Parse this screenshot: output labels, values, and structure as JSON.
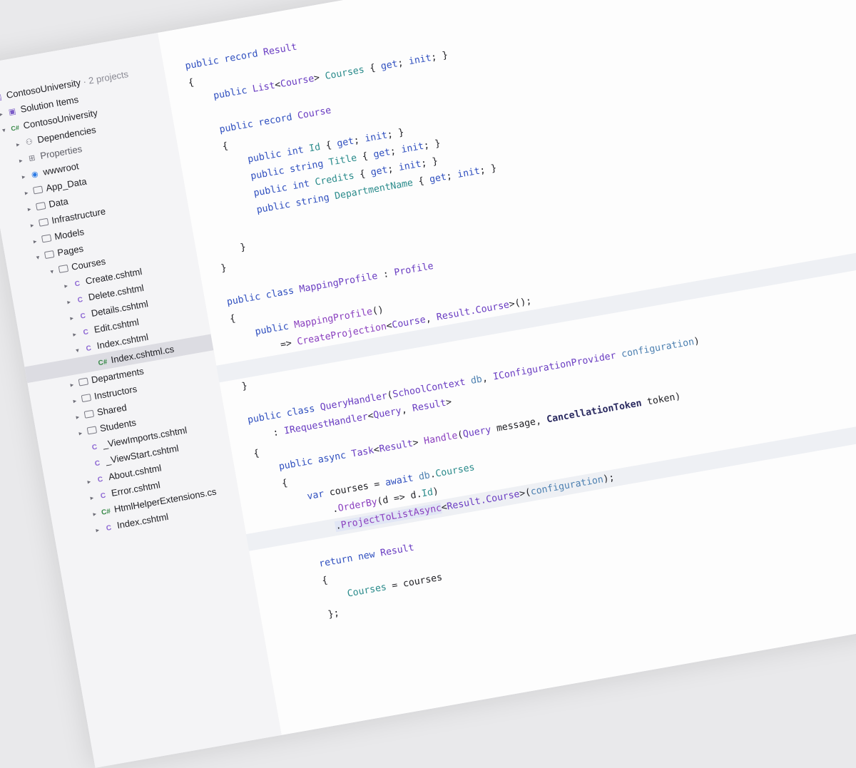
{
  "solution_tree": {
    "root": {
      "label": "ContosoUniversity",
      "meta": "· 2 projects"
    },
    "nodes": [
      {
        "label": "Solution Items",
        "depth": 1,
        "chevron": "▸",
        "icon": "solution-folder-icon"
      },
      {
        "label": "ContosoUniversity",
        "depth": 1,
        "chevron": "▾",
        "icon": "csharp-project-icon"
      },
      {
        "label": "Dependencies",
        "depth": 2,
        "chevron": "▸",
        "icon": "dependencies-icon"
      },
      {
        "label": "Properties",
        "depth": 2,
        "chevron": "▸",
        "icon": "properties-icon"
      },
      {
        "label": "wwwroot",
        "depth": 2,
        "chevron": "▸",
        "icon": "web-folder-icon"
      },
      {
        "label": "App_Data",
        "depth": 2,
        "chevron": "▸",
        "icon": "folder-icon"
      },
      {
        "label": "Data",
        "depth": 2,
        "chevron": "▸",
        "icon": "folder-icon"
      },
      {
        "label": "Infrastructure",
        "depth": 2,
        "chevron": "▸",
        "icon": "folder-icon"
      },
      {
        "label": "Models",
        "depth": 2,
        "chevron": "▸",
        "icon": "folder-icon"
      },
      {
        "label": "Pages",
        "depth": 2,
        "chevron": "▾",
        "icon": "folder-icon"
      },
      {
        "label": "Courses",
        "depth": 3,
        "chevron": "▾",
        "icon": "folder-icon"
      },
      {
        "label": "Create.cshtml",
        "depth": 4,
        "chevron": "▸",
        "icon": "razor-file-icon"
      },
      {
        "label": "Delete.cshtml",
        "depth": 4,
        "chevron": "▸",
        "icon": "razor-file-icon"
      },
      {
        "label": "Details.cshtml",
        "depth": 4,
        "chevron": "▸",
        "icon": "razor-file-icon"
      },
      {
        "label": "Edit.cshtml",
        "depth": 4,
        "chevron": "▸",
        "icon": "razor-file-icon"
      },
      {
        "label": "Index.cshtml",
        "depth": 4,
        "chevron": "▾",
        "icon": "razor-file-icon"
      },
      {
        "label": "Index.cshtml.cs",
        "depth": 5,
        "chevron": "",
        "icon": "csharp-file-icon",
        "selected": true
      },
      {
        "label": "Departments",
        "depth": 3,
        "chevron": "▸",
        "icon": "folder-icon"
      },
      {
        "label": "Instructors",
        "depth": 3,
        "chevron": "▸",
        "icon": "folder-icon"
      },
      {
        "label": "Shared",
        "depth": 3,
        "chevron": "▸",
        "icon": "folder-icon"
      },
      {
        "label": "Students",
        "depth": 3,
        "chevron": "▸",
        "icon": "folder-icon"
      },
      {
        "label": "_ViewImports.cshtml",
        "depth": 3,
        "chevron": "",
        "icon": "razor-file-icon"
      },
      {
        "label": "_ViewStart.cshtml",
        "depth": 3,
        "chevron": "",
        "icon": "razor-file-icon"
      },
      {
        "label": "About.cshtml",
        "depth": 3,
        "chevron": "▸",
        "icon": "razor-file-icon"
      },
      {
        "label": "Error.cshtml",
        "depth": 3,
        "chevron": "▸",
        "icon": "razor-file-icon"
      },
      {
        "label": "HtmlHelperExtensions.cs",
        "depth": 3,
        "chevron": "▸",
        "icon": "csharp-file-icon"
      },
      {
        "label": "Index.cshtml",
        "depth": 3,
        "chevron": "▸",
        "icon": "razor-file-icon"
      }
    ]
  },
  "code_lines": [
    {
      "indent": 0,
      "tokens": [
        [
          "kw",
          "public"
        ],
        [
          "",
          ""
        ],
        [
          "kw",
          " record "
        ],
        [
          "ty",
          "Result"
        ]
      ]
    },
    {
      "indent": 0,
      "tokens": [
        [
          "",
          "{"
        ]
      ]
    },
    {
      "indent": 4,
      "tokens": [
        [
          "kw",
          "public "
        ],
        [
          "ty",
          "List"
        ],
        [
          "",
          "<"
        ],
        [
          "ty",
          "Course"
        ],
        [
          "",
          "> "
        ],
        [
          "pr",
          "Courses"
        ],
        [
          "",
          " { "
        ],
        [
          "kw",
          "get"
        ],
        [
          "",
          "; "
        ],
        [
          "kw",
          "init"
        ],
        [
          "",
          "; }"
        ]
      ]
    },
    {
      "indent": 0,
      "tokens": []
    },
    {
      "indent": 4,
      "tokens": [
        [
          "kw",
          "public record "
        ],
        [
          "ty",
          "Course"
        ]
      ]
    },
    {
      "indent": 4,
      "tokens": [
        [
          "",
          "{"
        ]
      ]
    },
    {
      "indent": 8,
      "tokens": [
        [
          "kw",
          "public int "
        ],
        [
          "pr",
          "Id"
        ],
        [
          "",
          " { "
        ],
        [
          "kw",
          "get"
        ],
        [
          "",
          "; "
        ],
        [
          "kw",
          "init"
        ],
        [
          "",
          "; }"
        ]
      ]
    },
    {
      "indent": 8,
      "tokens": [
        [
          "kw",
          "public string "
        ],
        [
          "pr",
          "Title"
        ],
        [
          "",
          " { "
        ],
        [
          "kw",
          "get"
        ],
        [
          "",
          "; "
        ],
        [
          "kw",
          "init"
        ],
        [
          "",
          "; }"
        ]
      ]
    },
    {
      "indent": 8,
      "tokens": [
        [
          "kw",
          "public int "
        ],
        [
          "pr",
          "Credits"
        ],
        [
          "",
          " { "
        ],
        [
          "kw",
          "get"
        ],
        [
          "",
          "; "
        ],
        [
          "kw",
          "init"
        ],
        [
          "",
          "; }"
        ]
      ]
    },
    {
      "indent": 8,
      "tokens": [
        [
          "kw",
          "public string "
        ],
        [
          "pr",
          "DepartmentName"
        ],
        [
          "",
          " { "
        ],
        [
          "kw",
          "get"
        ],
        [
          "",
          "; "
        ],
        [
          "kw",
          "init"
        ],
        [
          "",
          "; }"
        ]
      ]
    },
    {
      "indent": 0,
      "tokens": []
    },
    {
      "indent": 4,
      "tokens": [
        [
          "",
          "}"
        ]
      ]
    },
    {
      "indent": 0,
      "tokens": [
        [
          "",
          "}"
        ]
      ]
    },
    {
      "indent": 0,
      "tokens": []
    },
    {
      "indent": 0,
      "tokens": [
        [
          "kw",
          "public class "
        ],
        [
          "ty",
          "MappingProfile"
        ],
        [
          "",
          " : "
        ],
        [
          "ty",
          "Profile"
        ]
      ]
    },
    {
      "indent": 0,
      "tokens": [
        [
          "",
          "{"
        ]
      ]
    },
    {
      "indent": 4,
      "tokens": [
        [
          "kw",
          "public "
        ],
        [
          "fn",
          "MappingProfile"
        ],
        [
          "",
          "()"
        ]
      ]
    },
    {
      "indent": 8,
      "tokens": [
        [
          "",
          "=> "
        ],
        [
          "fn",
          "CreateProjection"
        ],
        [
          "",
          "<"
        ],
        [
          "ty",
          "Course"
        ],
        [
          "",
          ", "
        ],
        [
          "ty",
          "Result.Course"
        ],
        [
          "",
          ">();"
        ]
      ]
    },
    {
      "indent": 0,
      "tokens": [],
      "hl": true
    },
    {
      "indent": 0,
      "tokens": [
        [
          "",
          "}"
        ]
      ]
    },
    {
      "indent": 0,
      "tokens": []
    },
    {
      "indent": 0,
      "tokens": [
        [
          "kw",
          "public class "
        ],
        [
          "ty",
          "QueryHandler"
        ],
        [
          "",
          "("
        ],
        [
          "ty",
          "SchoolContext"
        ],
        [
          "",
          " "
        ],
        [
          "pa",
          "db"
        ],
        [
          "",
          ", "
        ],
        [
          "ty",
          "IConfigurationProvider"
        ],
        [
          "",
          " "
        ],
        [
          "pa",
          "configuration"
        ],
        [
          "",
          ")"
        ]
      ]
    },
    {
      "indent": 4,
      "tokens": [
        [
          "",
          ": "
        ],
        [
          "ty",
          "IRequestHandler"
        ],
        [
          "",
          "<"
        ],
        [
          "ty",
          "Query"
        ],
        [
          "",
          ", "
        ],
        [
          "ty",
          "Result"
        ],
        [
          "",
          ">"
        ]
      ]
    },
    {
      "indent": 0,
      "tokens": [
        [
          "",
          "{"
        ]
      ]
    },
    {
      "indent": 4,
      "tokens": [
        [
          "kw",
          "public async "
        ],
        [
          "ty",
          "Task"
        ],
        [
          "",
          "<"
        ],
        [
          "ty",
          "Result"
        ],
        [
          "",
          "> "
        ],
        [
          "fn",
          "Handle"
        ],
        [
          "",
          "("
        ],
        [
          "ty",
          "Query"
        ],
        [
          "",
          " message, "
        ],
        [
          "bold",
          "CancellationToken"
        ],
        [
          "",
          " token)"
        ]
      ]
    },
    {
      "indent": 4,
      "tokens": [
        [
          "",
          "{"
        ]
      ]
    },
    {
      "indent": 8,
      "tokens": [
        [
          "kw",
          "var "
        ],
        [
          "",
          "courses = "
        ],
        [
          "kw",
          "await "
        ],
        [
          "pa",
          "db"
        ],
        [
          "",
          "."
        ],
        [
          "pr",
          "Courses"
        ]
      ]
    },
    {
      "indent": 12,
      "tokens": [
        [
          "",
          "."
        ],
        [
          "fn",
          "OrderBy"
        ],
        [
          "",
          "(d => d."
        ],
        [
          "pr",
          "Id"
        ],
        [
          "",
          ")"
        ]
      ]
    },
    {
      "indent": 12,
      "tokens": [
        [
          "sel",
          "."
        ],
        [
          "sel fn",
          "ProjectToListAsync"
        ],
        [
          "",
          "<"
        ],
        [
          "ty",
          "Result.Course"
        ],
        [
          "",
          ">("
        ],
        [
          "pa",
          "configuration"
        ],
        [
          "",
          ");"
        ]
      ],
      "hl": true
    },
    {
      "indent": 0,
      "tokens": []
    },
    {
      "indent": 8,
      "tokens": [
        [
          "kw",
          "return new "
        ],
        [
          "ty",
          "Result"
        ]
      ]
    },
    {
      "indent": 8,
      "tokens": [
        [
          "",
          "{"
        ]
      ]
    },
    {
      "indent": 12,
      "tokens": [
        [
          "pr",
          "Courses"
        ],
        [
          "",
          " = courses"
        ]
      ]
    },
    {
      "indent": 8,
      "tokens": [
        [
          "",
          "};"
        ]
      ]
    }
  ]
}
